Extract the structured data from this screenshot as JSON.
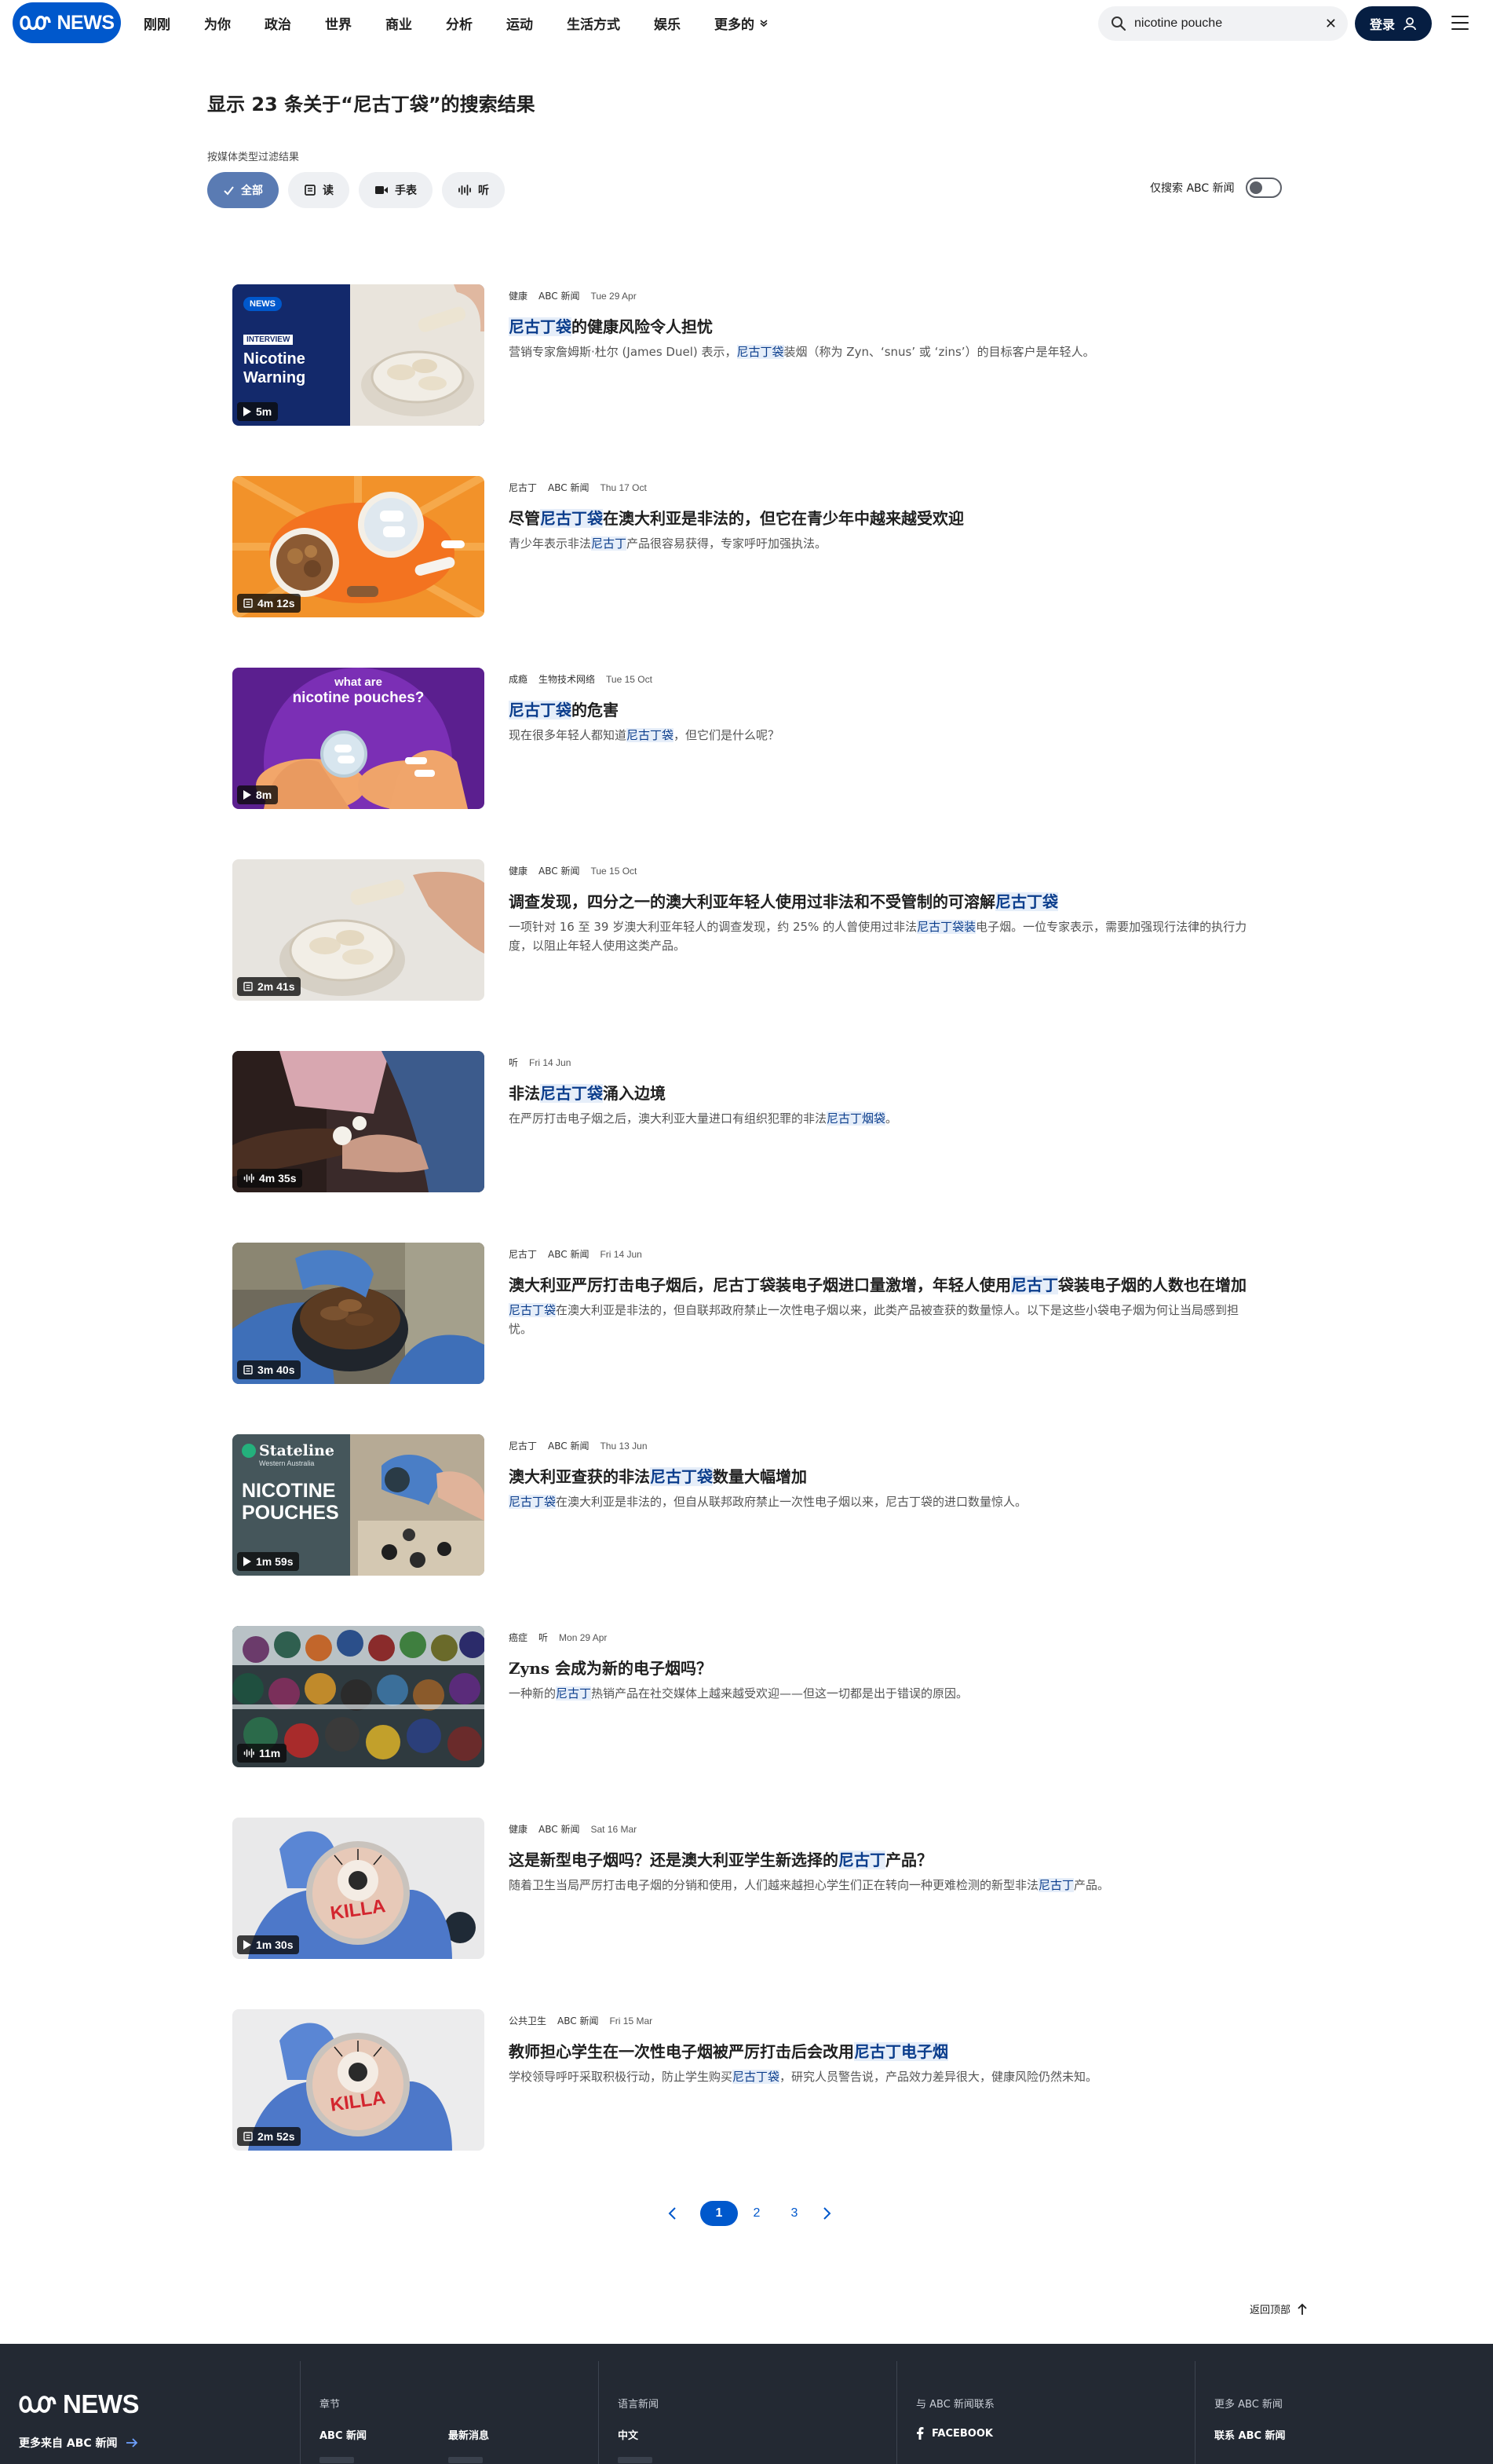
{
  "header": {
    "logo_text": "NEWS",
    "nav": [
      "刚刚",
      "为你",
      "政治",
      "世界",
      "商业",
      "分析",
      "运动",
      "生活方式",
      "娱乐",
      "更多的"
    ],
    "search_value": "nicotine pouche",
    "login_label": "登录",
    "brand_color": "#0058cc"
  },
  "results_title": "显示 23 条关于“尼古丁袋”的搜索结果",
  "filters": {
    "label": "按媒体类型过滤结果",
    "chips": [
      {
        "label": "全部",
        "icon": "check-icon",
        "active": true
      },
      {
        "label": "读",
        "icon": "article-icon",
        "active": false
      },
      {
        "label": "手表",
        "icon": "video-icon",
        "active": false
      },
      {
        "label": "听",
        "icon": "audio-icon",
        "active": false
      }
    ],
    "toggle_label": "仅搜索 ABC 新闻",
    "toggle_on": false
  },
  "results": [
    {
      "tags": [
        "健康",
        "ABC 新闻"
      ],
      "date": "Tue 29 Apr",
      "headline": [
        [
          "尼古丁袋",
          true
        ],
        [
          "的健康风险令人担忧",
          false
        ]
      ],
      "description": [
        [
          "营销专家詹姆斯·杜尔 (James Duel) 表示，",
          false
        ],
        [
          "尼古丁袋",
          true
        ],
        [
          "装烟（称为 Zyn、‘snus’ 或 ‘zins’）的目标客户是年轻人。",
          false
        ]
      ],
      "duration": "5m",
      "duration_icon": "play-icon",
      "thumb_text": {
        "badge": "NEWS",
        "kicker": "INTERVIEW",
        "title1": "Nicotine",
        "title2": "Warning"
      }
    },
    {
      "tags": [
        "尼古丁",
        "ABC 新闻"
      ],
      "date": "Thu 17 Oct",
      "headline": [
        [
          "尽管",
          false
        ],
        [
          "尼古丁袋",
          true
        ],
        [
          "在澳大利亚是非法的，但它在青少年中越来越受欢迎",
          false
        ]
      ],
      "description": [
        [
          "青少年表示非法",
          false
        ],
        [
          "尼古丁",
          true
        ],
        [
          "产品很容易获得，专家呼吁加强执法。",
          false
        ]
      ],
      "duration": "4m 12s",
      "duration_icon": "article-icon"
    },
    {
      "tags": [
        "成瘾",
        "生物技术网络"
      ],
      "date": "Tue 15 Oct",
      "headline": [
        [
          "尼古丁袋",
          true
        ],
        [
          "的危害",
          false
        ]
      ],
      "description": [
        [
          "现在很多年轻人都知道",
          false
        ],
        [
          "尼古丁袋",
          true
        ],
        [
          "，但它们是什么呢？",
          false
        ]
      ],
      "duration": "8m",
      "duration_icon": "play-icon",
      "thumb_text": {
        "line1": "what are",
        "line2": "nicotine pouches?"
      }
    },
    {
      "tags": [
        "健康",
        "ABC 新闻"
      ],
      "date": "Tue 15 Oct",
      "headline": [
        [
          "调查发现，四分之一的澳大利亚年轻人使用过非法和不受管制的可溶解",
          false
        ],
        [
          "尼古丁袋",
          true
        ]
      ],
      "description": [
        [
          "一项针对 16 至 39 岁澳大利亚年轻人的调查发现，约 25% 的人曾使用过非法",
          false
        ],
        [
          "尼古丁袋装",
          true
        ],
        [
          "电子烟。一位专家表示，需要加强现行法律的执行力度，以阻止年轻人使用这类产品。",
          false
        ]
      ],
      "duration": "2m 41s",
      "duration_icon": "article-icon"
    },
    {
      "tags": [
        "听"
      ],
      "date": "Fri 14 Jun",
      "headline": [
        [
          "非法",
          false
        ],
        [
          "尼古丁袋",
          true
        ],
        [
          "涌入边境",
          false
        ]
      ],
      "description": [
        [
          "在严厉打击电子烟之后，澳大利亚大量进口有组织犯罪的非法",
          false
        ],
        [
          "尼古丁烟袋",
          true
        ],
        [
          "。",
          false
        ]
      ],
      "duration": "4m 35s",
      "duration_icon": "audio-icon"
    },
    {
      "tags": [
        "尼古丁",
        "ABC 新闻"
      ],
      "date": "Fri 14 Jun",
      "headline": [
        [
          "澳大利亚严厉打击电子烟后，尼古丁袋装电子烟进口量激增，年轻人使用",
          false
        ],
        [
          "尼古丁",
          true
        ],
        [
          "袋装电子烟的人数也在增加",
          false
        ]
      ],
      "description": [
        [
          "尼古丁袋",
          true
        ],
        [
          "在澳大利亚是非法的，但自联邦政府禁止一次性电子烟以来，此类产品被查获的数量惊人。以下是这些小袋电子烟为何让当局感到担忧。",
          false
        ]
      ],
      "duration": "3m 40s",
      "duration_icon": "article-icon"
    },
    {
      "tags": [
        "尼古丁",
        "ABC 新闻"
      ],
      "date": "Thu 13 Jun",
      "headline": [
        [
          "澳大利亚查获的非法",
          false
        ],
        [
          "尼古丁袋",
          true
        ],
        [
          "数量大幅增加",
          false
        ]
      ],
      "description": [
        [
          "尼古丁袋",
          true
        ],
        [
          "在澳大利亚是非法的，但自从联邦政府禁止一次性电子烟以来，尼古丁袋的进口数量惊人。",
          false
        ]
      ],
      "duration": "1m 59s",
      "duration_icon": "play-icon",
      "thumb_text": {
        "brand": "Stateline",
        "sub": "Western Australia",
        "title1": "NICOTINE",
        "title2": "POUCHES"
      }
    },
    {
      "tags": [
        "癌症",
        "听"
      ],
      "date": "Mon 29 Apr",
      "headline": [
        [
          "Zyns 会成为新的电子烟吗？",
          false
        ]
      ],
      "description": [
        [
          "一种新的",
          false
        ],
        [
          "尼古丁",
          true
        ],
        [
          "热销产品在社交媒体上越来越受欢迎——但这一切都是出于错误的原因。",
          false
        ]
      ],
      "duration": "11m",
      "duration_icon": "audio-icon"
    },
    {
      "tags": [
        "健康",
        "ABC 新闻"
      ],
      "date": "Sat 16 Mar",
      "headline": [
        [
          "这是新型电子烟吗？还是澳大利亚学生新选择的",
          false
        ],
        [
          "尼古丁",
          true
        ],
        [
          "产品？",
          false
        ]
      ],
      "description": [
        [
          "随着卫生当局严厉打击电子烟的分销和使用，人们越来越担心学生们正在转向一种更难检测的新型非法",
          false
        ],
        [
          "尼古丁",
          true
        ],
        [
          "产品。",
          false
        ]
      ],
      "duration": "1m 30s",
      "duration_icon": "play-icon",
      "thumb_text": {
        "can": "KILLA"
      }
    },
    {
      "tags": [
        "公共卫生",
        "ABC 新闻"
      ],
      "date": "Fri 15 Mar",
      "headline": [
        [
          "教师担心学生在一次性电子烟被严厉打击后会改用",
          false
        ],
        [
          "尼古丁电子烟",
          true
        ]
      ],
      "description": [
        [
          "学校领导呼吁采取积极行动，防止学生购买",
          false
        ],
        [
          "尼古丁袋",
          true
        ],
        [
          "，研究人员警告说，产品效力差异很大，健康风险仍然未知。",
          false
        ]
      ],
      "duration": "2m 52s",
      "duration_icon": "article-icon",
      "thumb_text": {
        "can": "KILLA"
      }
    }
  ],
  "pagination": {
    "pages": [
      "1",
      "2",
      "3"
    ],
    "current": "1"
  },
  "back_to_top": "返回顶部",
  "footer": {
    "logo_text": "NEWS",
    "more_from": "更多来自 ABC 新闻",
    "columns": [
      {
        "title": "章节",
        "links": [
          "ABC 新闻",
          "最新消息"
        ]
      },
      {
        "title": "语言新闻",
        "links": [
          "中文"
        ]
      },
      {
        "title": "与 ABC 新闻联系",
        "links": [
          "FACEBOOK"
        ]
      },
      {
        "title": "更多 ABC 新闻",
        "links": [
          "联系 ABC 新闻"
        ]
      }
    ]
  }
}
